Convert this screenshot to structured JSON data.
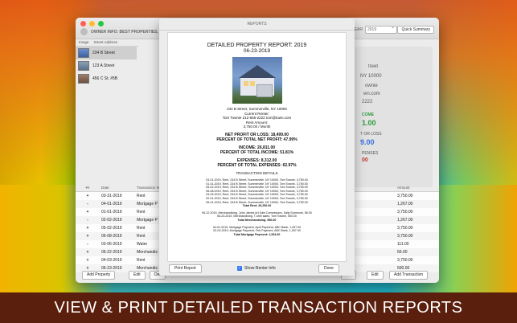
{
  "window": {
    "owner_info": "OWNER INFO: BEST PROPERTIES, LL",
    "year_label": "YEAR",
    "year_value": "2019",
    "quick_summary_label": "Quick Summary"
  },
  "property_list": {
    "headers": [
      "Image",
      "Street Address"
    ],
    "items": [
      {
        "address": "234 B Street"
      },
      {
        "address": "123 A Street"
      },
      {
        "address": "456 C St. #5B"
      }
    ]
  },
  "right_pane": {
    "line1": "treet",
    "line2": "NY 10000",
    "line3": "ownie",
    "line4": "wn.com",
    "line5": "2222",
    "income_label": "COME",
    "income_value": "1.00",
    "profit_label": "T OR LOSS",
    "profit_value": "9.00",
    "expenses_label": "PENSES",
    "expenses_value": "00"
  },
  "transactions": {
    "headers": {
      "pm": "+/-",
      "date": "Date",
      "type": "Transaction N",
      "amount": "Amount"
    },
    "rows": [
      {
        "pm": "+",
        "date": "03-31-2019",
        "type": "Rent",
        "amount": "3,750.00"
      },
      {
        "pm": "-",
        "date": "04-01-2019",
        "type": "Mortgage P",
        "amount": "1,267.00"
      },
      {
        "pm": "+",
        "date": "01-01-2019",
        "type": "Rent",
        "amount": "3,750.00"
      },
      {
        "pm": "-",
        "date": "02-02-2019",
        "type": "Mortgage P",
        "amount": "1,267.00"
      },
      {
        "pm": "+",
        "date": "05-02-2019",
        "type": "Rent",
        "amount": "3,750.00"
      },
      {
        "pm": "+",
        "date": "06-08-2019",
        "type": "Rent",
        "amount": "3,750.00"
      },
      {
        "pm": "-",
        "date": "03-06-2019",
        "type": "Water",
        "amount": "111.00"
      },
      {
        "pm": "+",
        "date": "06-22-2019",
        "type": "Merchandis",
        "amount": "56.00"
      },
      {
        "pm": "+",
        "date": "04-03-2019",
        "type": "Rent",
        "amount": "3,750.00"
      },
      {
        "pm": "+",
        "date": "06-23-2019",
        "type": "Merchandis",
        "amount": "500.00"
      }
    ]
  },
  "bottom_buttons": {
    "add_property": "Add Property",
    "edit": "Edit",
    "delete_partial": "Del",
    "delete_right_partial": "ete",
    "edit_right": "Edit",
    "add_transaction": "Add Transaction"
  },
  "report": {
    "sheet_title": "REPORTS",
    "title": "DETAILED PROPERTY REPORT: 2019",
    "date": "06-23-2019",
    "address_line": "234 B Street, Summerville, NY 10000",
    "renter_label": "Current Renter:",
    "renter_info": "Tom Townie 212-555-2222 tom@town.com",
    "rent_label": "Rent Amount:",
    "rent_value": "3,750.00 / Month",
    "net_profit": "NET PROFIT OR LOSS: 18,499.00",
    "net_percent": "PERCENT OF TOTAL NET PROFIT: 47.99%",
    "income": "INCOME: 26,811.00",
    "income_percent": "PERCENT OF TOTAL INCOME: 51.81%",
    "expenses": "EXPENSES: 8,312.00",
    "expenses_percent": "PERCENT OF TOTAL EXPENSES: 62.97%",
    "details_label": "TRANSACTION DETAILS",
    "rent_lines": [
      "03-01-2019, Rent, 234 B Street, Summerville, NY 10000, Tom Townie, 3,750.00",
      "01-01-2019, Rent, 234 B Street, Summerville, NY 10000, Tom Townie, 3,750.00",
      "05-02-2019, Rent, 234 B Street, Summerville, NY 10000, Tom Townie, 3,750.00",
      "06-08-2019, Rent, 234 B Street, Summerville, NY 10000, Tom Townie, 3,750.00",
      "04-03-2019, Rent, 234 B Street, Summerville, NY 10000, Tom Townie, 3,750.00",
      "02-01-2019, Rent, 234 B Street, Summerville, NY 10000, Tom Townie, 3,750.00",
      "06-01-2019, Rent, 234 B Street, Summerville, NY 10000, Tom Townie, 3,750.00"
    ],
    "total_rent": "Total Rent: 26,250.00",
    "merch_lines": [
      "06-22-2019, Merchandising, John James Art Sale Commission, Sally Someone, 56.00",
      "06-23-2019, Merchandising, T-shirt sales, Tom Townie, 500.00"
    ],
    "total_merch": "Total Merchandising: 556.00",
    "mortgage_lines": [
      "04-01-2019, Mortgage Payment, April Payment, ABC Bank, 1,267.00",
      "02-02-2019, Mortgage Payment, Feb Payment, ABC Bank, 1,267.00"
    ],
    "total_mortgage": "Total Mortgage Payment: 2,534.00",
    "print_label": "Print Report",
    "show_renter_label": "Show Renter Info",
    "done_label": "Done"
  },
  "banner": {
    "text": "VIEW & PRINT DETAILED TRANSACTION REPORTS"
  },
  "colors": {
    "banner_bg": "#5b1f0e",
    "accent_blue": "#3478f6",
    "income_green": "#2e9b3e",
    "profit_blue": "#3a6fe0"
  }
}
